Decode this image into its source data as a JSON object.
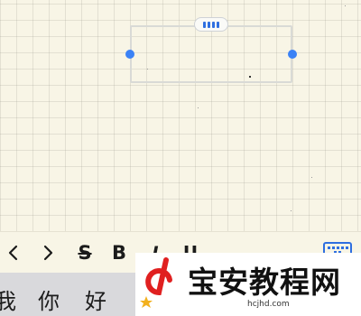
{
  "toolbar": {
    "back_icon": "chevron-left-icon",
    "forward_icon": "chevron-right-icon",
    "strike_label": "S",
    "bold_label": "B",
    "italic_label": "I",
    "underline_label": "U",
    "keyboard_icon": "keyboard-icon",
    "accent_color": "#2f6fe0"
  },
  "ime": {
    "candidates": [
      "我",
      "你",
      "好"
    ]
  },
  "watermark": {
    "title": "宝安教程网",
    "url": "hcjhd.com",
    "logo_color": "#e02020"
  },
  "canvas": {
    "handle_color": "#3b82f6"
  }
}
